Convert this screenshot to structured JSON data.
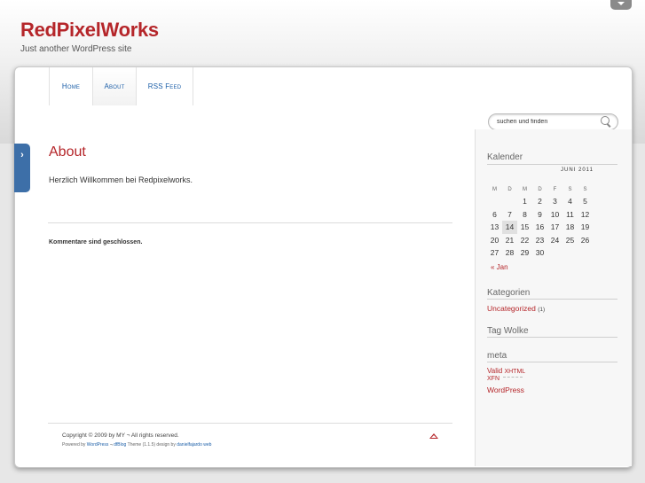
{
  "site": {
    "title": "RedPixelWorks",
    "tagline": "Just another WordPress site"
  },
  "nav": {
    "items": [
      {
        "label": "Home"
      },
      {
        "label": "About"
      },
      {
        "label": "RSS Feed"
      }
    ]
  },
  "search": {
    "value": "suchen und finden"
  },
  "page": {
    "title": "About",
    "body": "Herzlich Willkommen bei Redpixelworks.",
    "comments_closed": "Kommentare sind geschlossen."
  },
  "footer": {
    "copyright": "Copyright © 2009 by MY ¬ All rights reserved.",
    "powered_prefix": "Powered by",
    "wordpress": "WordPress",
    "sep": "¬",
    "theme_link": "dfBlog",
    "theme_suffix": "Theme (1.1.5) design by",
    "designer": "danielfajardo web"
  },
  "sidebar": {
    "calendar": {
      "title": "Kalender",
      "caption": "JUNI 2011",
      "days": [
        "M",
        "D",
        "M",
        "D",
        "F",
        "S",
        "S"
      ],
      "weeks": [
        [
          "",
          "",
          "1",
          "2",
          "3",
          "4",
          "5"
        ],
        [
          "6",
          "7",
          "8",
          "9",
          "10",
          "11",
          "12"
        ],
        [
          "13",
          "14",
          "15",
          "16",
          "17",
          "18",
          "19"
        ],
        [
          "20",
          "21",
          "22",
          "23",
          "24",
          "25",
          "26"
        ],
        [
          "27",
          "28",
          "29",
          "30",
          "",
          "",
          ""
        ]
      ],
      "today": "14",
      "prev": "« Jan"
    },
    "categories": {
      "title": "Kategorien",
      "items": [
        {
          "label": "Uncategorized",
          "count": "(1)"
        }
      ]
    },
    "tags": {
      "title": "Tag Wolke"
    },
    "meta": {
      "title": "meta",
      "valid": "Valid",
      "xhtml": "XHTML",
      "xfn": "XFN",
      "wordpress": "WordPress"
    }
  },
  "colors": {
    "accent": "#b5262a",
    "link": "#1c5fa8",
    "tab": "#3d6fa8"
  }
}
